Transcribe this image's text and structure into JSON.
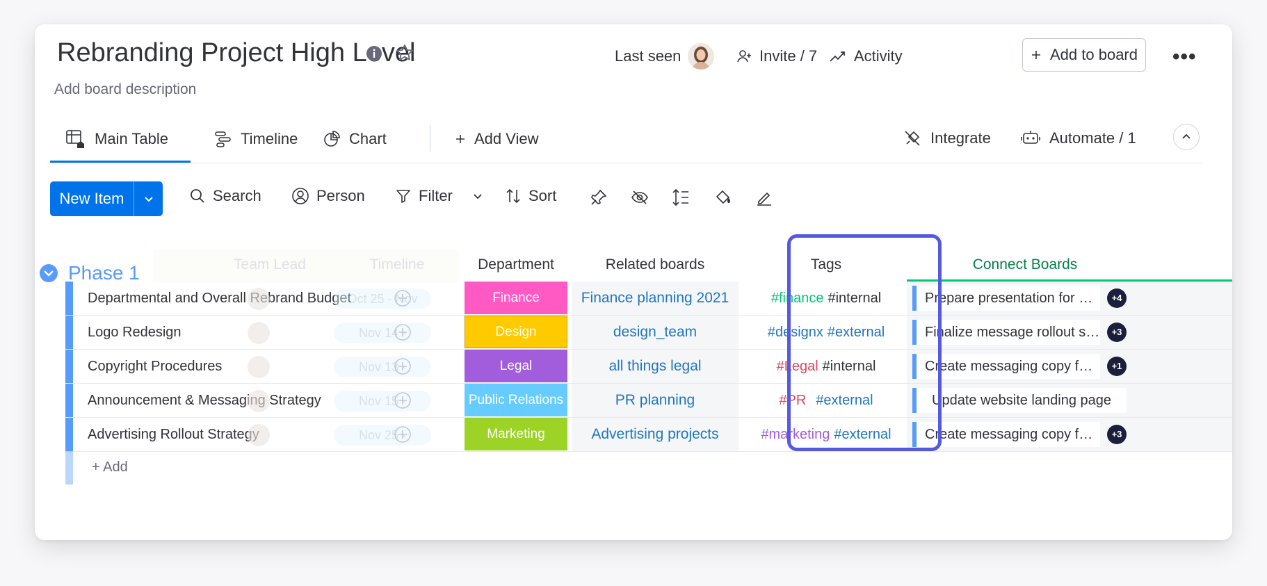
{
  "header": {
    "title": "Rebranding Project High Level",
    "description": "Add board description",
    "last_seen_label": "Last seen",
    "invite_label": "Invite / 7",
    "activity_label": "Activity",
    "add_to_board_label": "Add to board",
    "more_icon": "•••"
  },
  "tabs": {
    "main_table": "Main Table",
    "timeline": "Timeline",
    "chart": "Chart",
    "add_view": "Add View",
    "integrate": "Integrate",
    "automate": "Automate / 1"
  },
  "toolbar": {
    "new_item": "New Item",
    "search": "Search",
    "person": "Person",
    "filter": "Filter",
    "sort": "Sort"
  },
  "group": {
    "name": "Phase 1",
    "color": "#579bfc",
    "columns": {
      "team_lead": "Team Lead",
      "timeline": "Timeline",
      "department": "Department",
      "related_boards": "Related boards",
      "tags": "Tags",
      "connect_boards": "Connect Boards"
    },
    "add_label": "+ Add",
    "rows": [
      {
        "name": "Departmental and Overall Rebrand Budget",
        "timeline": "Oct 25 - Nov",
        "department": "Finance",
        "department_color": "#ff5ac4",
        "related": "Finance planning 2021",
        "tag1": "#finance",
        "tag1_color": "#00c875",
        "tag2": "#internal",
        "tag2_color": "#323338",
        "connect": "Prepare presentation for board",
        "connect_badge": "+4"
      },
      {
        "name": "Logo Redesign",
        "timeline": "Nov 14 -",
        "department": "Design",
        "department_color": "#ffcb00",
        "related": "design_team",
        "tag1": "#designx",
        "tag1_color": "#1f76c2",
        "tag2": "#external",
        "tag2_color": "#1f76c2",
        "connect": "Finalize message rollout strategy",
        "connect_badge": "+3"
      },
      {
        "name": "Copyright Procedures",
        "timeline": "Nov 13 -",
        "department": "Legal",
        "department_color": "#a25ddc",
        "related": "all things legal",
        "tag1": "#Legal",
        "tag1_color": "#e2445c",
        "tag2": "#internal",
        "tag2_color": "#323338",
        "connect": "Create messaging copy for social",
        "connect_badge": "+1"
      },
      {
        "name": "Announcement & Messaging Strategy",
        "timeline": "Nov 15 -",
        "department": "Public Relations",
        "department_color": "#66ccff",
        "related": "PR planning",
        "tag1": "#PR",
        "tag1_color": "#e2445c",
        "tag2": "#external",
        "tag2_color": "#1f76c2",
        "connect": "Update website landing page",
        "connect_badge": ""
      },
      {
        "name": "Advertising Rollout Strategy",
        "timeline": "Nov 25 -",
        "department": "Marketing",
        "department_color": "#9cd326",
        "related": "Advertising projects",
        "tag1": "#marketing",
        "tag1_color": "#a25ddc",
        "tag2": "#external",
        "tag2_color": "#1f76c2",
        "connect": "Create messaging copy for website",
        "connect_badge": "+3"
      }
    ]
  }
}
